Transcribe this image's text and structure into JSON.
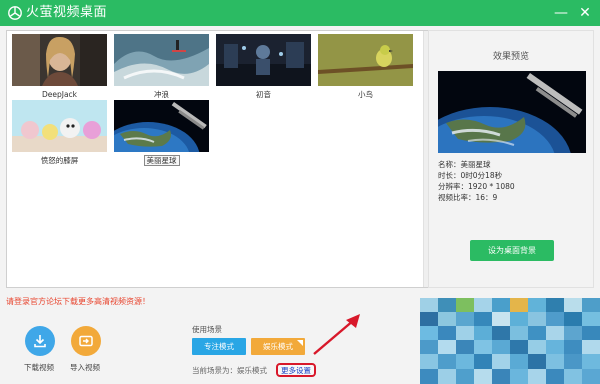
{
  "window": {
    "title": "火萤视频桌面",
    "minimize_label": "—",
    "close_label": "✕"
  },
  "gallery": {
    "items": [
      {
        "label": "DeepJack",
        "selected": false
      },
      {
        "label": "冲浪",
        "selected": false
      },
      {
        "label": "初音",
        "selected": false
      },
      {
        "label": "小鸟",
        "selected": false
      },
      {
        "label": "愤怒的膝屏",
        "selected": false
      },
      {
        "label": "美丽星球",
        "selected": true
      }
    ]
  },
  "preview": {
    "title": "效果预览",
    "name": "名称：美丽星球",
    "duration": "时长：0时0分18秒",
    "resolution": "分辨率：1920 * 1080",
    "ratio": "视频比率：16：9",
    "set_background_label": "设为桌面背景"
  },
  "notice": "请登录官方论坛下载更多高清视频资源！",
  "footer": {
    "download_label": "下载视频",
    "import_label": "导入视频",
    "use_scene_label": "使用场景",
    "focus_mode_label": "专注模式",
    "fun_mode_label": "娱乐模式",
    "current_scene_label": "当前场景为：娱乐模式",
    "more_settings_label": "更多设置"
  },
  "colors": {
    "brand_green": "#2bbb63",
    "focus_blue": "#29a6e5",
    "fun_orange": "#f2a93a",
    "notice_red": "#e8442e",
    "highlight_red": "#d8182a"
  },
  "icons": {
    "logo": "app-logo-icon",
    "download": "download-icon",
    "import": "import-icon",
    "annotation": "red-arrow-icon"
  }
}
